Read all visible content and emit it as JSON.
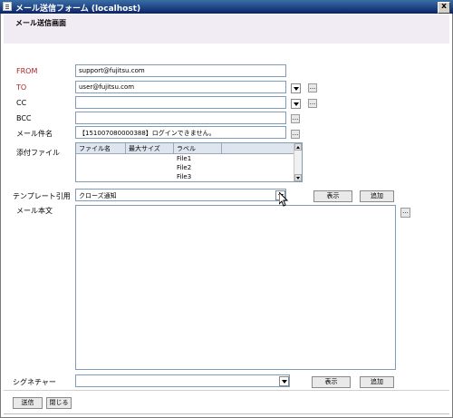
{
  "window": {
    "title": "メール送信フォーム (localhost)",
    "close_label": "x"
  },
  "header": {
    "title": "メール送信画面"
  },
  "form": {
    "from": {
      "label": "FROM",
      "value": "support@fujitsu.com"
    },
    "to": {
      "label": "TO",
      "value": "user@fujitsu.com"
    },
    "cc": {
      "label": "CC",
      "value": ""
    },
    "bcc": {
      "label": "BCC",
      "value": ""
    },
    "subject": {
      "label": "メール件名",
      "value": "【151007080000388】ログインできません。"
    },
    "attachments": {
      "label": "添付ファイル",
      "columns": [
        "ファイル名",
        "最大サイズ",
        "ラベル"
      ],
      "rows": [
        {
          "name": "",
          "size": "",
          "label": "File1"
        },
        {
          "name": "",
          "size": "",
          "label": "File2"
        },
        {
          "name": "",
          "size": "",
          "label": "File3"
        }
      ]
    },
    "template": {
      "label": "テンプレート引用",
      "value": "クローズ通知"
    },
    "body": {
      "label": "メール本文",
      "value": ""
    },
    "signature": {
      "label": "シグネチャー",
      "value": ""
    }
  },
  "buttons": {
    "dots": "...",
    "show": "表示",
    "add": "追加",
    "send": "送信",
    "close": "閉じる"
  },
  "colors": {
    "required_label": "#b22222",
    "titlebar": "#0a246a",
    "header_band": "#f1ecf3"
  },
  "icons": [
    "window-icon",
    "close-icon",
    "dropdown-arrow-icon",
    "scroll-up-icon",
    "scroll-down-icon",
    "mouse-cursor-icon"
  ]
}
